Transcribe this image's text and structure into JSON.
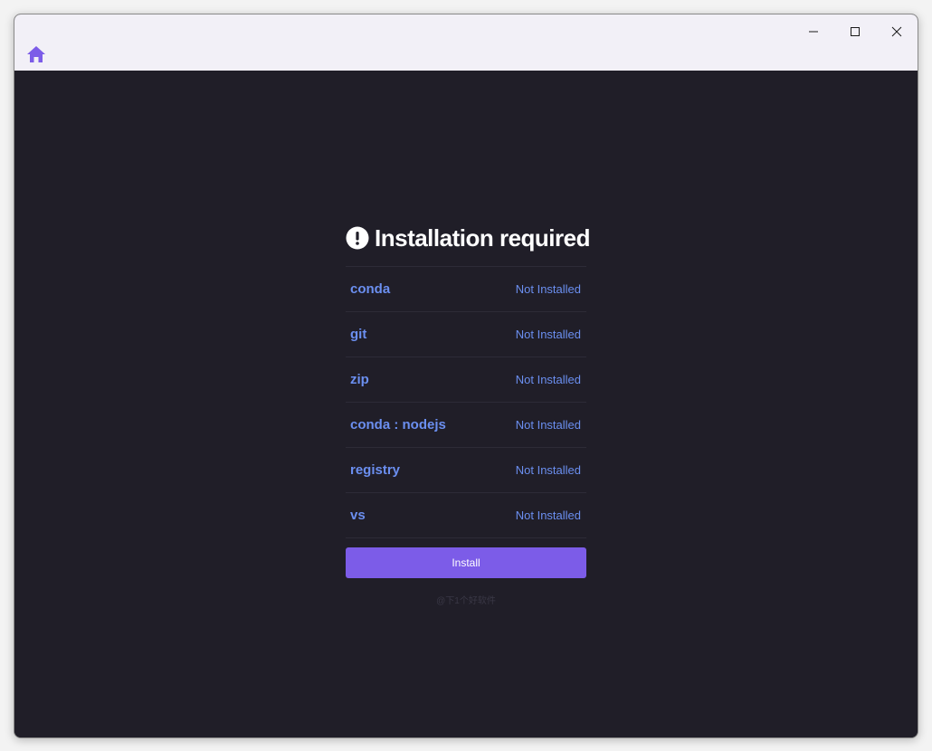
{
  "window": {
    "controls": {
      "minimize_icon": "minimize-icon",
      "maximize_icon": "maximize-icon",
      "close_icon": "close-icon"
    }
  },
  "toolbar": {
    "home_icon": "home-icon",
    "accent_color": "#7c5ce8"
  },
  "main": {
    "heading": "Installation required",
    "heading_icon": "exclamation-circle-icon",
    "requirements": [
      {
        "name": "conda",
        "status": "Not Installed"
      },
      {
        "name": "git",
        "status": "Not Installed"
      },
      {
        "name": "zip",
        "status": "Not Installed"
      },
      {
        "name": "conda : nodejs",
        "status": "Not Installed"
      },
      {
        "name": "registry",
        "status": "Not Installed"
      },
      {
        "name": "vs",
        "status": "Not Installed"
      }
    ],
    "install_label": "Install",
    "watermark": "@下1个好软件"
  },
  "colors": {
    "background": "#201e28",
    "titlebar": "#f2f0f7",
    "link": "#6b8ff0",
    "button": "#7c5ce8"
  }
}
